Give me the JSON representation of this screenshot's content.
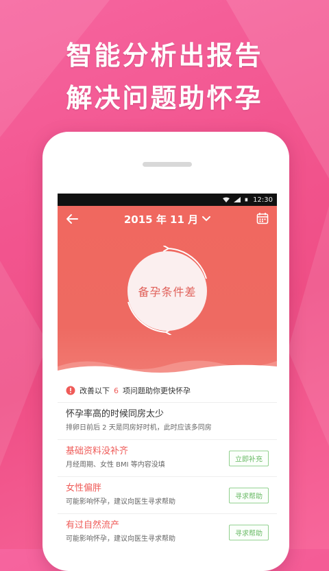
{
  "headline": {
    "line1": "智能分析出报告",
    "line2": "解决问题助怀孕"
  },
  "status_bar": {
    "time": "12:30"
  },
  "header": {
    "month": "2015 年 11 月"
  },
  "status_circle": {
    "label": "备孕条件差"
  },
  "notice": {
    "prefix": "改善以下",
    "count": "6",
    "suffix": "项问题助你更快怀孕"
  },
  "items": [
    {
      "title": "怀孕率高的时候同房太少",
      "subtitle": "排卵日前后 2 天是同房好时机，此时应该多同房",
      "action": ""
    },
    {
      "title": "基础资料没补齐",
      "subtitle": "月经周期、女性 BMI 等内容没填",
      "action": "立即补充"
    },
    {
      "title": "女性偏胖",
      "subtitle": "可能影响怀孕，建议向医生寻求帮助",
      "action": "寻求帮助"
    },
    {
      "title": "有过自然流产",
      "subtitle": "可能影响怀孕，建议向医生寻求帮助",
      "action": "寻求帮助"
    }
  ],
  "colors": {
    "accent": "#ef5b58",
    "hero": "#ee6a62",
    "button_green": "#6aba66",
    "background": "#f2558f"
  },
  "icons": [
    "back-arrow-icon",
    "chevron-down-icon",
    "calendar-icon",
    "warning-icon",
    "wifi-icon",
    "signal-icon",
    "battery-icon"
  ]
}
